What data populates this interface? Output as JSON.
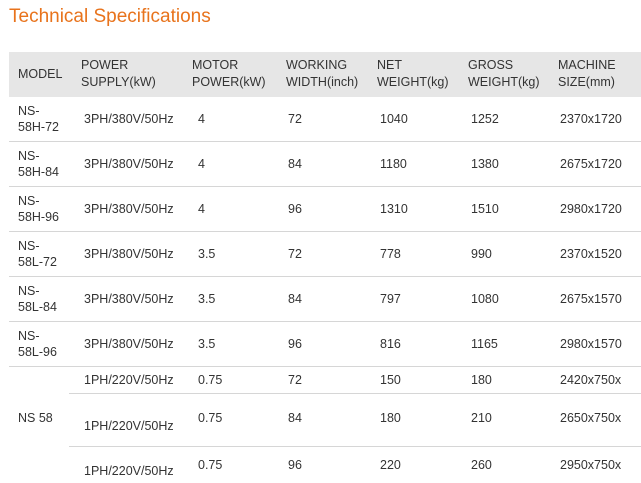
{
  "page": {
    "title": "Technical Specifications"
  },
  "table": {
    "headers": [
      "MODEL",
      "POWER\nSUPPLY(kW)",
      "MOTOR\nPOWER(kW)",
      "WORKING\nWIDTH(inch)",
      "NET\nWEIGHT(kg)",
      "GROSS\nWEIGHT(kg)",
      "MACHINE\nSIZE(mm)"
    ],
    "rows": [
      {
        "model": "NS-\n58H-72",
        "power_supply": "3PH/380V/50Hz",
        "motor_power": "4",
        "working_width": "72",
        "net_weight": "1040",
        "gross_weight": "1252",
        "machine_size": "2370x1720"
      },
      {
        "model": "NS-\n58H-84",
        "power_supply": "3PH/380V/50Hz",
        "motor_power": "4",
        "working_width": "84",
        "net_weight": "1180",
        "gross_weight": "1380",
        "machine_size": "2675x1720"
      },
      {
        "model": "NS-\n58H-96",
        "power_supply": "3PH/380V/50Hz",
        "motor_power": "4",
        "working_width": "96",
        "net_weight": "1310",
        "gross_weight": "1510",
        "machine_size": "2980x1720"
      },
      {
        "model": "NS-\n58L-72",
        "power_supply": "3PH/380V/50Hz",
        "motor_power": "3.5",
        "working_width": "72",
        "net_weight": "778",
        "gross_weight": "990",
        "machine_size": "2370x1520"
      },
      {
        "model": "NS-\n58L-84",
        "power_supply": "3PH/380V/50Hz",
        "motor_power": "3.5",
        "working_width": "84",
        "net_weight": "797",
        "gross_weight": "1080",
        "machine_size": "2675x1570"
      },
      {
        "model": "NS-\n58L-96",
        "power_supply": "3PH/380V/50Hz",
        "motor_power": "3.5",
        "working_width": "96",
        "net_weight": "816",
        "gross_weight": "1165",
        "machine_size": "2980x1570"
      }
    ],
    "group": {
      "model": "NS 58",
      "rows": [
        {
          "power_supply": "1PH/220V/50Hz",
          "motor_power": "0.75",
          "working_width": "72",
          "net_weight": "150",
          "gross_weight": "180",
          "machine_size": "2420x750x"
        },
        {
          "power_supply": "1PH/220V/50Hz",
          "motor_power": "0.75",
          "working_width": "84",
          "net_weight": "180",
          "gross_weight": "210",
          "machine_size": "2650x750x"
        },
        {
          "power_supply": "1PH/220V/50Hz",
          "motor_power": "0.75",
          "working_width": "96",
          "net_weight": "220",
          "gross_weight": "260",
          "machine_size": "2950x750x"
        }
      ]
    }
  },
  "colors": {
    "title": "#e8731c",
    "header_bg": "#e6e6e6",
    "border": "#d6d6d6",
    "text": "#333333"
  }
}
